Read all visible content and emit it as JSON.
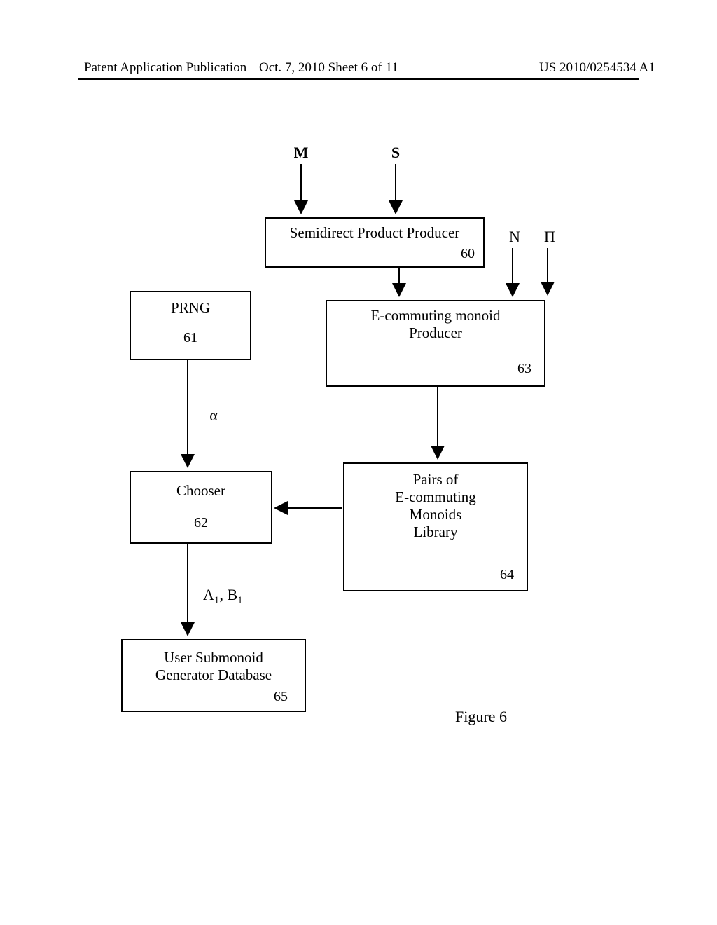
{
  "header": {
    "left": "Patent Application Publication",
    "mid": "Oct. 7, 2010   Sheet 6 of 11",
    "right": "US 2010/0254534 A1"
  },
  "inputs": {
    "M": "M",
    "S": "S",
    "N": "N",
    "Pi": "Π"
  },
  "boxes": {
    "spp": {
      "label": "Semidirect Product Producer",
      "num": "60"
    },
    "prng": {
      "label": "PRNG",
      "num": "61"
    },
    "ecp": {
      "label1": "E-commuting monoid",
      "label2": "Producer",
      "num": "63"
    },
    "chooser": {
      "label": "Chooser",
      "num": "62"
    },
    "lib": {
      "label1": "Pairs of",
      "label2": "E-commuting",
      "label3": "Monoids",
      "label4": "Library",
      "num": "64"
    },
    "usg": {
      "label1": "User Submonoid",
      "label2": "Generator Database",
      "num": "65"
    }
  },
  "edges": {
    "alpha": "α",
    "ab": "A₁, B₁"
  },
  "caption": "Figure 6"
}
